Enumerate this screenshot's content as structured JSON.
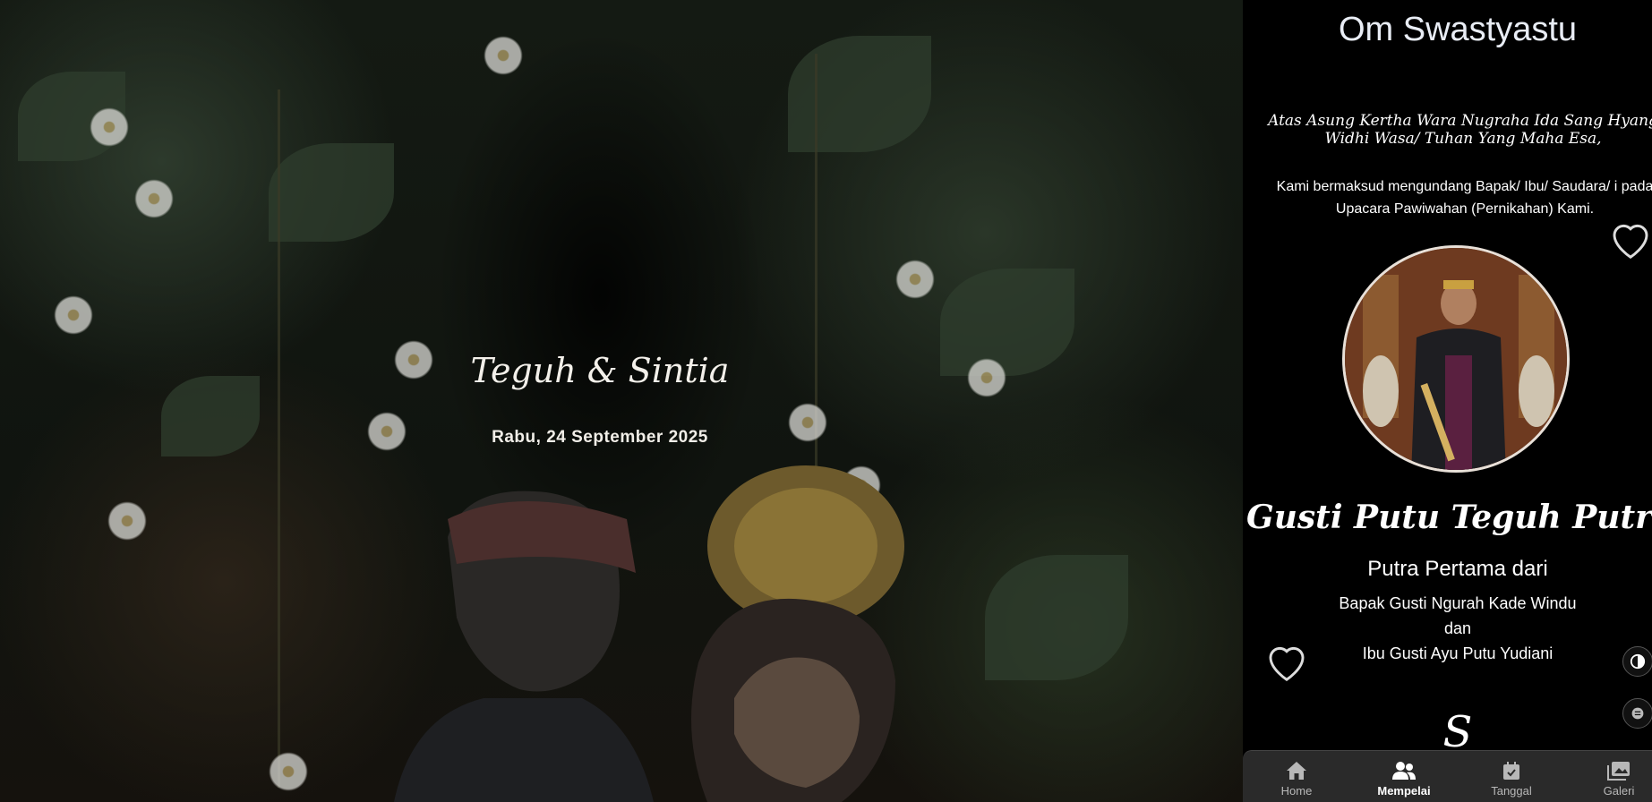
{
  "hero": {
    "title": "Teguh & Sintia",
    "date": "Rabu, 24 September 2025"
  },
  "panel": {
    "greeting": "Om Swastyastu",
    "blessing": "Atas Asung Kertha Wara Nugraha Ida Sang Hyang Widhi Wasa/ Tuhan Yang Maha Esa,",
    "invite": "Kami bermaksud mengundang Bapak/ Ibu/ Saudara/ i pada Upacara Pawiwahan (Pernikahan) Kami.",
    "groom": {
      "name": "Gusti Putu Teguh Putra Pratama",
      "child_of": "Putra Pertama dari",
      "father": "Bapak Gusti Ngurah Kade Windu",
      "conjunction": "dan",
      "mother": "Ibu Gusti Ayu Putu Yudiani"
    },
    "next_initial": "S"
  },
  "nav": {
    "items": [
      {
        "label": "Home",
        "icon": "home-icon",
        "active": false
      },
      {
        "label": "Mempelai",
        "icon": "users-icon",
        "active": true
      },
      {
        "label": "Tanggal",
        "icon": "calendar-check-icon",
        "active": false
      },
      {
        "label": "Galeri",
        "icon": "images-icon",
        "active": false
      }
    ]
  },
  "colors": {
    "panel_bg": "#000000",
    "nav_bg": "#2a2a2a",
    "text": "#ffffff"
  }
}
